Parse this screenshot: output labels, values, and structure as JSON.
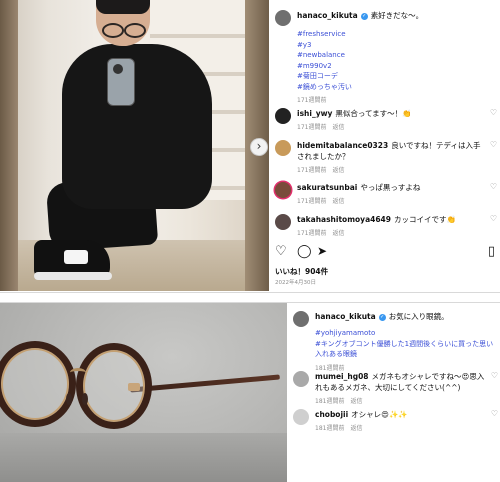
{
  "post1": {
    "author": "hanaco_kikuta",
    "caption": "素好きだな〜。",
    "hashtags": [
      "#freshservice",
      "#y3",
      "#newbalance",
      "#m990v2",
      "#菊田コーデ",
      "#鏡めっちゃ汚い"
    ],
    "caption_time": "171週間前",
    "comments": [
      {
        "user": "ishi_ywy",
        "text": "黒似合ってます〜！👏",
        "time": "171週間前",
        "reply": "返信"
      },
      {
        "user": "hidemitabalance0323",
        "text": "良いですね！テディは入手されましたか？",
        "time": "171週間前",
        "reply": "返信"
      },
      {
        "user": "sakuratsunbai",
        "text": "やっぱ黒っすよね",
        "time": "171週間前",
        "reply": "返信"
      },
      {
        "user": "takahashitomoya4649",
        "text": "カッコイイです👏",
        "time": "171週間前",
        "reply": "返信"
      }
    ],
    "likes": "いいね！904件",
    "date": "2022年4月30日",
    "icons": {
      "like": "heart-icon",
      "comment": "comment-icon",
      "share": "share-icon",
      "save": "bookmark-icon",
      "next": "chevron-right-icon"
    }
  },
  "post2": {
    "author": "hanaco_kikuta",
    "caption": "お気に入り眼鏡。",
    "hashtags": [
      "#yohjiyamamoto",
      "#キングオブコント優勝した1週間後くらいに買った思い入れある眼鏡"
    ],
    "caption_time": "181週間前",
    "comments": [
      {
        "user": "mumei_hg08",
        "text": "メガネもオシャレですね〜😍思入れもあるメガネ、大切にしてください(^^)",
        "time": "181週間前",
        "reply": "返信"
      },
      {
        "user": "chobojii",
        "text": "オシャレ😍✨✨",
        "time": "181週間前",
        "reply": "返信"
      }
    ]
  },
  "colors": {
    "link": "#3b4fd6",
    "muted": "#8e8e8e",
    "verified": "#3897f0"
  }
}
